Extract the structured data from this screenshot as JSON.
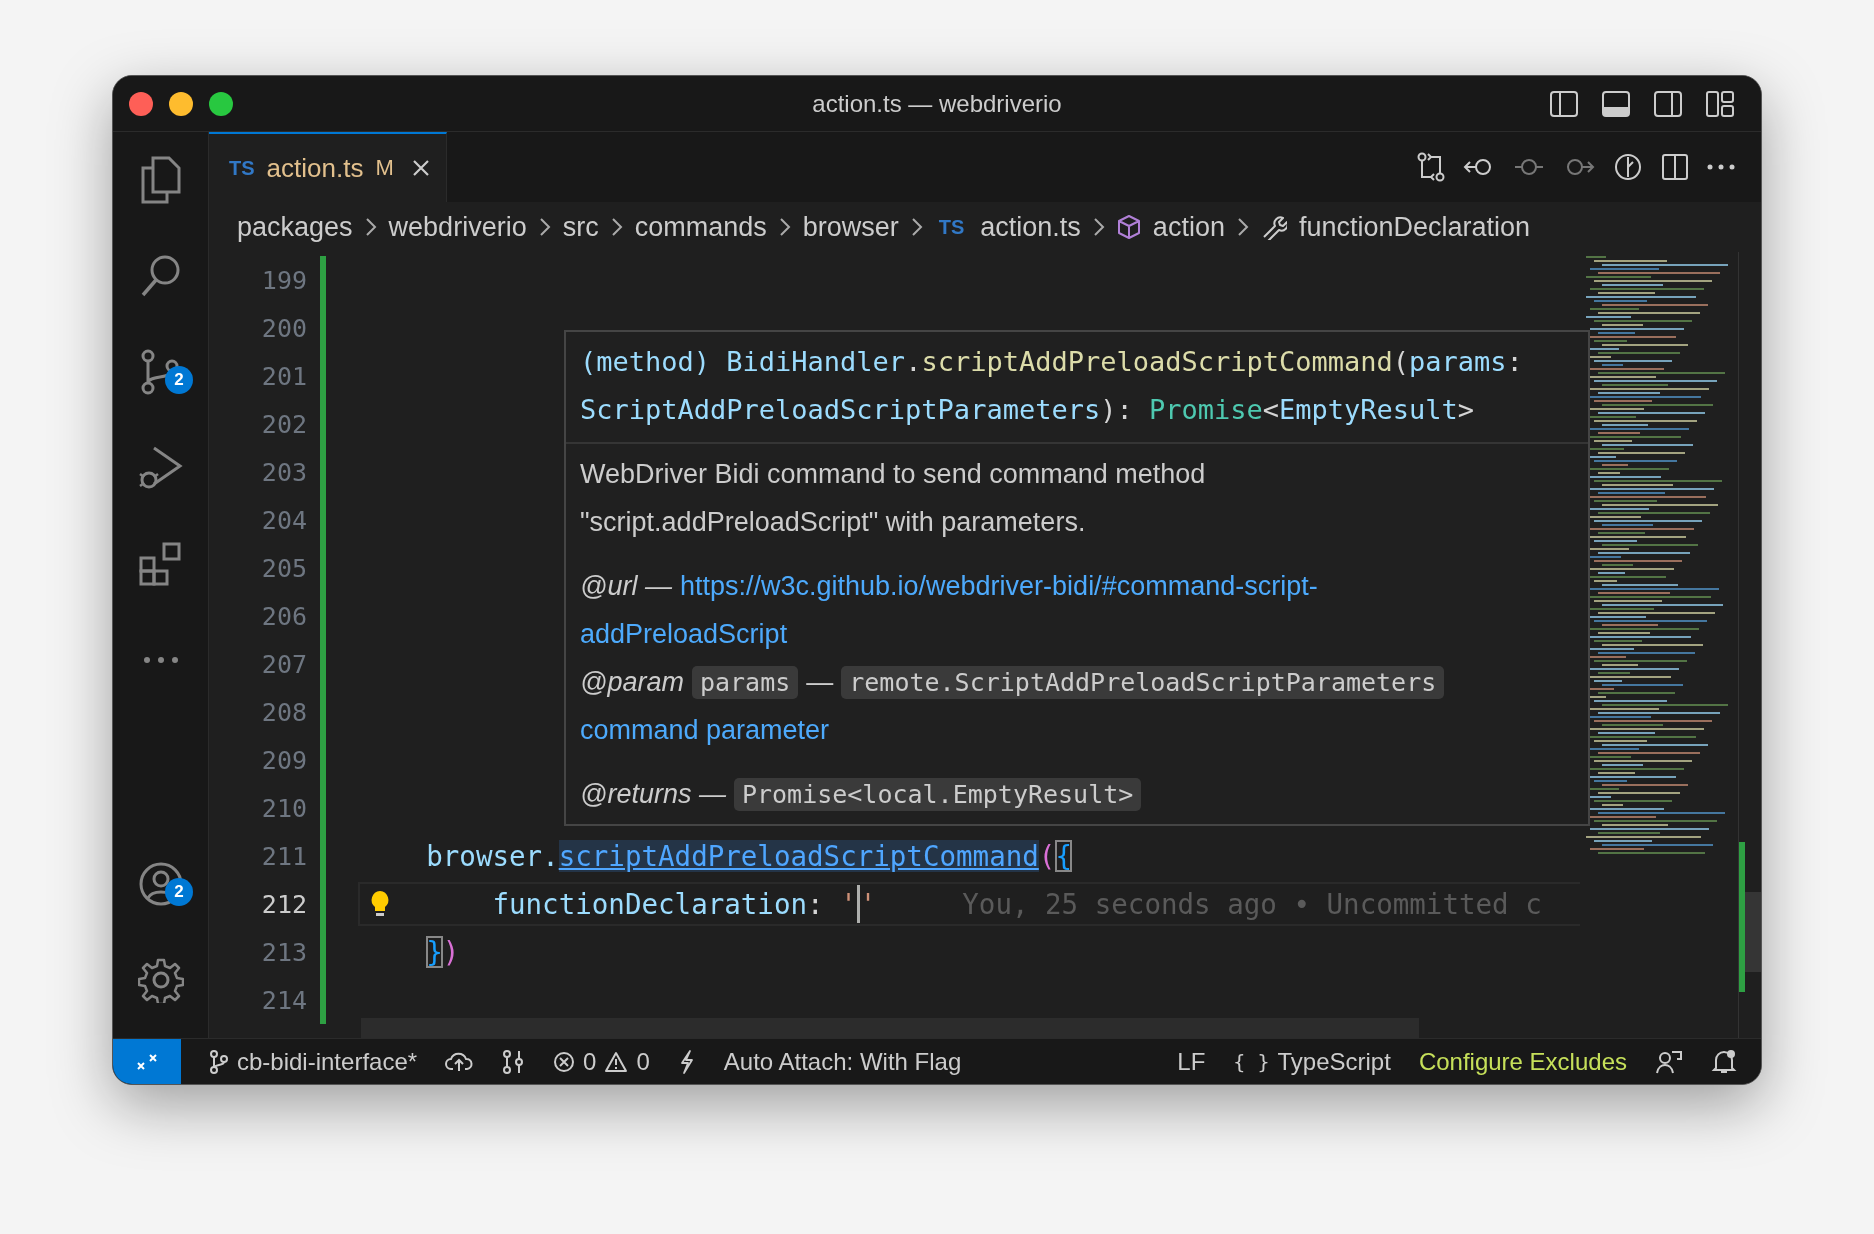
{
  "window": {
    "title": "action.ts — webdriverio"
  },
  "activity_bar": {
    "top": [
      {
        "kind": "explorer"
      },
      {
        "kind": "search"
      },
      {
        "kind": "source-control",
        "badge": "2"
      },
      {
        "kind": "run"
      },
      {
        "kind": "extensions"
      },
      {
        "kind": "more"
      }
    ],
    "bottom": [
      {
        "kind": "accounts",
        "badge": "2"
      },
      {
        "kind": "settings"
      }
    ]
  },
  "tabs": [
    {
      "lang": "TS",
      "label": "action.ts",
      "status": "M",
      "selected": true
    }
  ],
  "breadcrumbs": [
    {
      "kind": "folder",
      "text": "packages"
    },
    {
      "kind": "folder",
      "text": "webdriverio"
    },
    {
      "kind": "folder",
      "text": "src"
    },
    {
      "kind": "folder",
      "text": "commands"
    },
    {
      "kind": "folder",
      "text": "browser"
    },
    {
      "kind": "file",
      "badge": "TS",
      "text": "action.ts"
    },
    {
      "kind": "module",
      "text": "action"
    },
    {
      "kind": "property",
      "text": "functionDeclaration"
    }
  ],
  "editor": {
    "blame": "You, 25 seconds ago • Uncommitted c",
    "lines": [
      {
        "number": "199",
        "current": false
      },
      {
        "number": "200",
        "current": false
      },
      {
        "number": "201",
        "current": false
      },
      {
        "number": "202",
        "current": false
      },
      {
        "number": "203",
        "current": false
      },
      {
        "number": "204",
        "current": false
      },
      {
        "number": "205",
        "current": false
      },
      {
        "number": "206",
        "current": false
      },
      {
        "number": "207",
        "current": false
      },
      {
        "number": "208",
        "current": false
      },
      {
        "number": "209",
        "current": false
      },
      {
        "number": "210",
        "current": false
      },
      {
        "number": "211",
        "current": false,
        "tokens": [
          {
            "text": "    browser.",
            "kind": "var"
          },
          {
            "text": "scriptAddPreloadScriptCommand",
            "kind": "link"
          },
          {
            "text": "(",
            "kind": "paren"
          },
          {
            "text": "{",
            "kind": "brace-match"
          }
        ]
      },
      {
        "number": "212",
        "current": true,
        "tokens": [
          {
            "text": "        functionDeclaration",
            "kind": "var"
          },
          {
            "text": ": ",
            "kind": "punct"
          },
          {
            "text": "'",
            "kind": "string"
          },
          {
            "text": "'",
            "kind": "string-cursor"
          }
        ]
      },
      {
        "number": "213",
        "current": false,
        "tokens": [
          {
            "text": "    }",
            "kind": "brace-match"
          },
          {
            "text": ")",
            "kind": "paren"
          }
        ]
      },
      {
        "number": "214",
        "current": false
      }
    ]
  },
  "hover": {
    "signature_lines": [
      [
        {
          "text": "(method) ",
          "kind": "var"
        },
        {
          "text": "BidiHandler",
          "kind": "var"
        },
        {
          "text": ".",
          "kind": "punct"
        },
        {
          "text": "scriptAddPreloadScriptCommand",
          "kind": "func"
        },
        {
          "text": "(",
          "kind": "punct"
        },
        {
          "text": "params",
          "kind": "var"
        },
        {
          "text": ":",
          "kind": "punct"
        }
      ],
      [
        {
          "text": "ScriptAddPreloadScriptParameters",
          "kind": "var"
        },
        {
          "text": "): ",
          "kind": "punct"
        },
        {
          "text": "Promise",
          "kind": "type"
        },
        {
          "text": "<",
          "kind": "punct"
        },
        {
          "text": "EmptyResult",
          "kind": "var"
        },
        {
          "text": ">",
          "kind": "punct"
        }
      ]
    ],
    "description": "WebDriver Bidi command to send command method \"script.addPreloadScript\" with parameters.",
    "url_tag": "@url —",
    "url_lines": [
      "https://w3c.github.io/webdriver-bidi/#command-script-",
      "addPreloadScript"
    ],
    "param_tag": "@param",
    "param_name": "params",
    "param_dash": "—",
    "param_type": "remote.ScriptAddPreloadScriptParameters",
    "param_text": "command parameter",
    "returns_tag": "@returns —",
    "returns_type": "Promise<local.EmptyResult>"
  },
  "status_bar": {
    "branch": "cb-bidi-interface*",
    "errors": "0",
    "warnings": "0",
    "auto_attach": "Auto Attach: With Flag",
    "eol": "LF",
    "language_icon": "{ }",
    "language": "TypeScript",
    "action": "Configure Excludes"
  }
}
